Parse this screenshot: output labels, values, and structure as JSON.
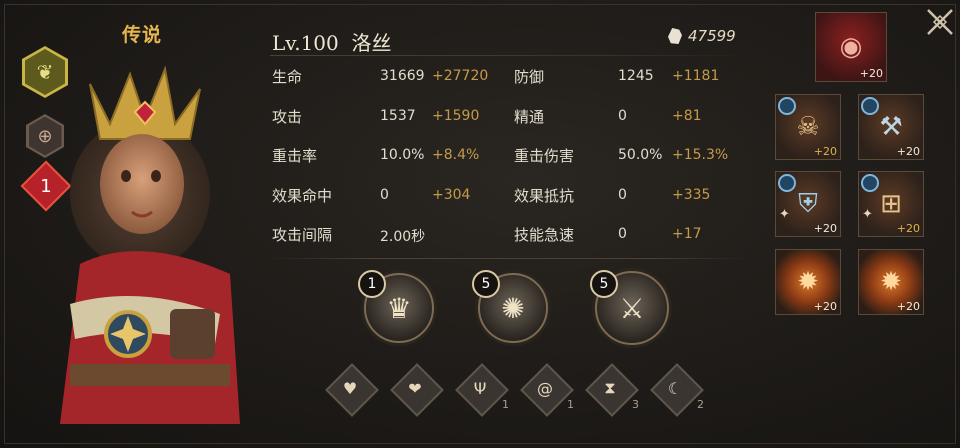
{
  "rarity": "传说",
  "hero": {
    "level": "Lv.100",
    "name": "洛丝",
    "power": "47599"
  },
  "left_rail": {
    "level_badge": "1"
  },
  "stats": [
    {
      "left": {
        "name": "生命",
        "base": "31669",
        "bonus": "+27720"
      },
      "right": {
        "name": "防御",
        "base": "1245",
        "bonus": "+1181"
      }
    },
    {
      "left": {
        "name": "攻击",
        "base": "1537",
        "bonus": "+1590"
      },
      "right": {
        "name": "精通",
        "base": "0",
        "bonus": "+81"
      }
    },
    {
      "left": {
        "name": "重击率",
        "base": "10.0%",
        "bonus": "+8.4%"
      },
      "right": {
        "name": "重击伤害",
        "base": "50.0%",
        "bonus": "+15.3%"
      }
    },
    {
      "left": {
        "name": "效果命中",
        "base": "0",
        "bonus": "+304"
      },
      "right": {
        "name": "效果抵抗",
        "base": "0",
        "bonus": "+335"
      }
    },
    {
      "left": {
        "name": "攻击间隔",
        "base": "2.00秒",
        "bonus": ""
      },
      "right": {
        "name": "技能急速",
        "base": "0",
        "bonus": "+17"
      }
    }
  ],
  "skills": [
    {
      "level": "1",
      "icon": "face-crown-icon"
    },
    {
      "level": "5",
      "icon": "feather-swirl-icon"
    },
    {
      "level": "5",
      "icon": "slash-strike-icon"
    }
  ],
  "runes": [
    {
      "icon": "heart-icon",
      "count": ""
    },
    {
      "icon": "heart-hand-icon",
      "count": ""
    },
    {
      "icon": "trident-icon",
      "count": "1"
    },
    {
      "icon": "swirl-icon",
      "count": "1"
    },
    {
      "icon": "hourglass-icon",
      "count": "3"
    },
    {
      "icon": "spiral-icon",
      "count": "2"
    }
  ],
  "equipment": [
    {
      "slot": "boss",
      "icon": "eye-creature-icon",
      "level": "+20"
    },
    {
      "slot": "weapon-1",
      "icon": "skull-gauntlet-icon",
      "level": "+20"
    },
    {
      "slot": "weapon-2",
      "icon": "hammer-icon",
      "level": "+20"
    },
    {
      "slot": "armor-1",
      "icon": "chest-armor-icon",
      "level": "+20"
    },
    {
      "slot": "armor-2",
      "icon": "bracer-icon",
      "level": "+20"
    },
    {
      "slot": "orb-1",
      "icon": "fire-orb-icon",
      "level": "+20"
    },
    {
      "slot": "orb-2",
      "icon": "fire-orb-icon",
      "level": "+20"
    }
  ],
  "colors": {
    "gold": "#e6b64d",
    "bonus": "#c69a4a",
    "badge_red": "#b7222a",
    "class_green": "#c9b446"
  }
}
